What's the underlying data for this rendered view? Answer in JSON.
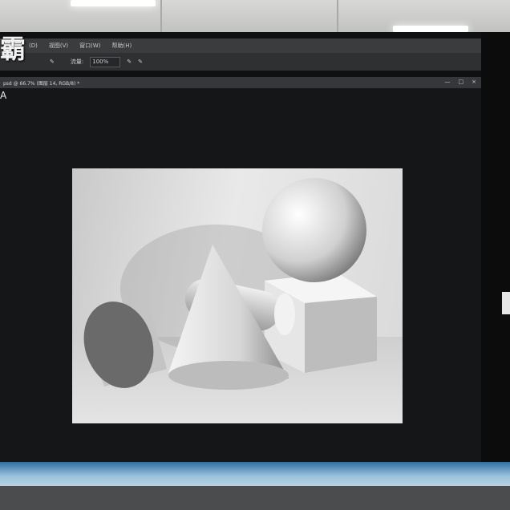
{
  "app": {
    "watermark_text": "霸",
    "side_mark": "A"
  },
  "menubar": {
    "items": [
      "(D)",
      "视图(V)",
      "窗口(W)",
      "帮助(H)"
    ]
  },
  "options_bar": {
    "opacity_label": "流量:",
    "zoom_value": "100%"
  },
  "document": {
    "tab_title": "psd @ 66.7% (图层 14, RGB/8) *",
    "controls": [
      "—",
      "□",
      "×"
    ]
  },
  "colors": {
    "background": "#1f2022",
    "canvas": "#151617",
    "screen_frame": "#2e6fa0"
  },
  "icons": [
    "brush-icon",
    "tablet-pressure-icon"
  ]
}
